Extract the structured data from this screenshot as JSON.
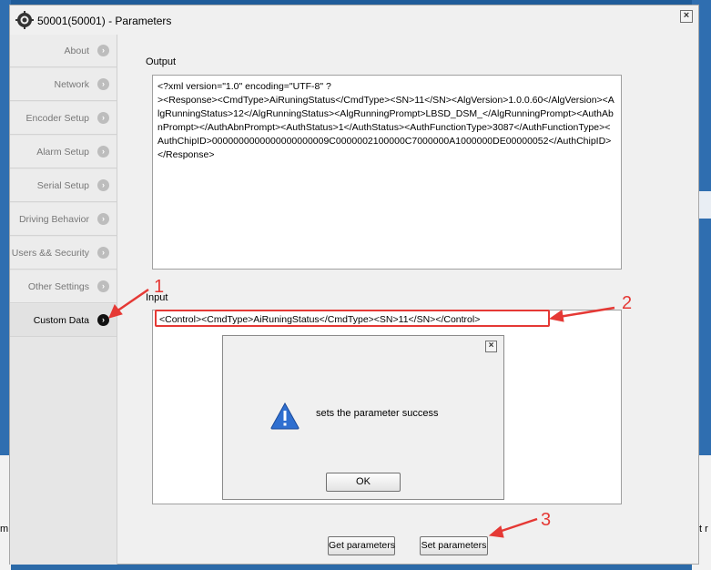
{
  "window": {
    "title": "50001(50001) - Parameters",
    "close_label": "×"
  },
  "sidebar": {
    "items": [
      {
        "label": "About",
        "active": false
      },
      {
        "label": "Network",
        "active": false
      },
      {
        "label": "Encoder Setup",
        "active": false
      },
      {
        "label": "Alarm Setup",
        "active": false
      },
      {
        "label": "Serial Setup",
        "active": false
      },
      {
        "label": "Driving Behavior",
        "active": false
      },
      {
        "label": "Users && Security",
        "active": false
      },
      {
        "label": "Other Settings",
        "active": false
      },
      {
        "label": "Custom Data",
        "active": true
      }
    ],
    "chevron": "›"
  },
  "output": {
    "label": "Output",
    "text": "<?xml version=\"1.0\" encoding=\"UTF-8\" ?\n><Response><CmdType>AiRuningStatus</CmdType><SN>11</SN><AlgVersion>1.0.0.60</AlgVersion><AlgRunningStatus>12</AlgRunningStatus><AlgRunningPrompt>LBSD_DSM_</AlgRunningPrompt><AuthAbnPrompt></AuthAbnPrompt><AuthStatus>1</AuthStatus><AuthFunctionType>3087</AuthFunctionType><AuthChipID>0000000000000000000009C0000002100000C7000000A1000000DE00000052</AuthChipID></Response>"
  },
  "input": {
    "label": "Input",
    "text": "<Control><CmdType>AiRuningStatus</CmdType><SN>11</SN></Control>"
  },
  "dialog": {
    "message": "sets the parameter success",
    "ok_label": "OK",
    "close_label": "×"
  },
  "buttons": {
    "get_label": "Get parameters",
    "set_label": "Set parameters"
  },
  "annotations": {
    "n1": "1",
    "n2": "2",
    "n3": "3"
  },
  "background": {
    "left_fragment": "m",
    "right_fragment": "t r"
  },
  "colors": {
    "annotation": "#e53935",
    "window_bg": "#f0f0f0",
    "desktop": "#2b6aa8"
  }
}
